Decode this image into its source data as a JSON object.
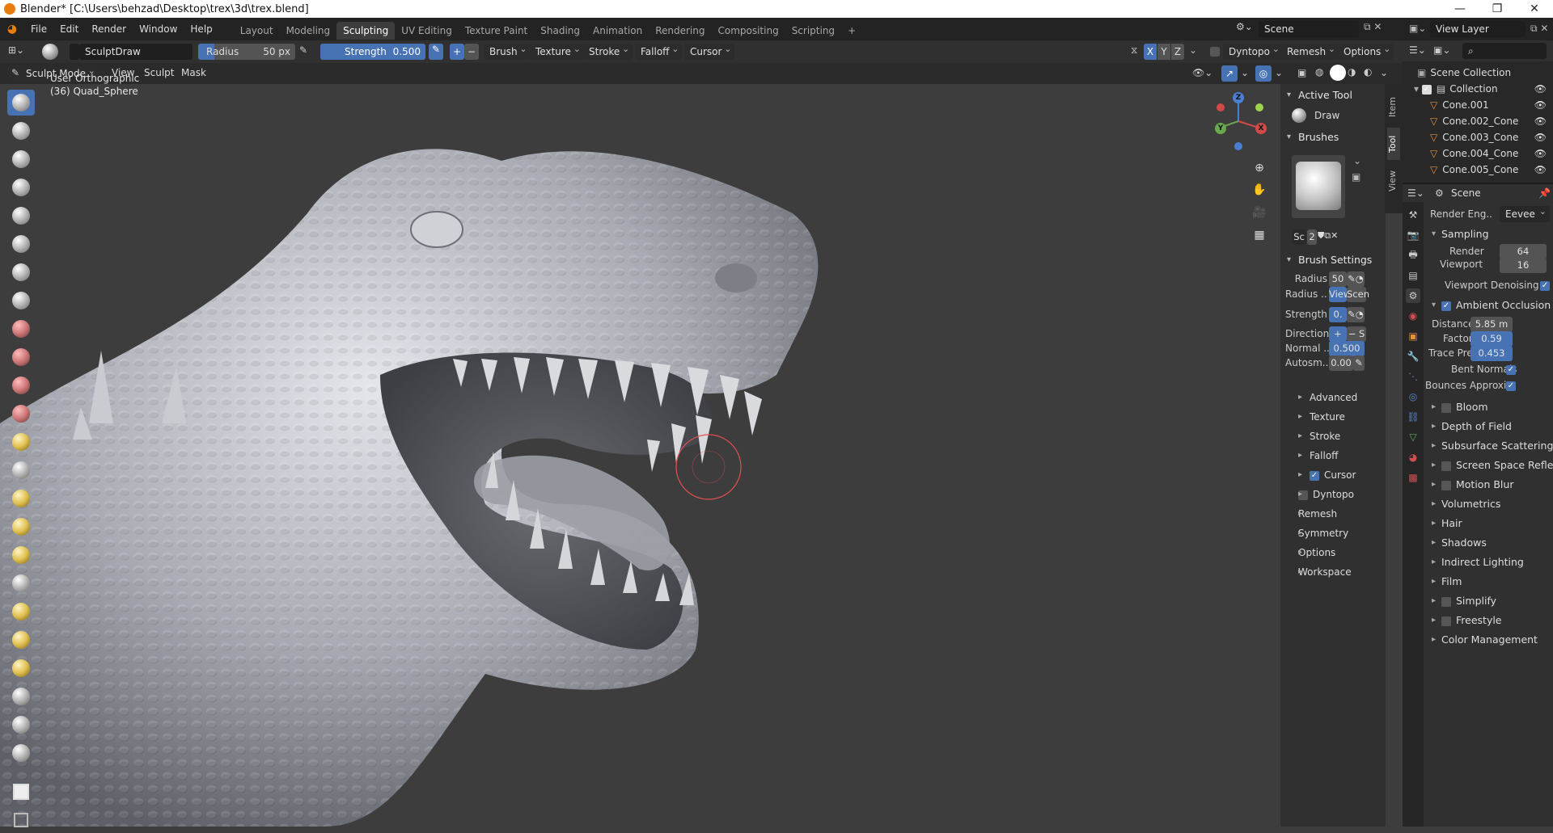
{
  "window": {
    "title": "Blender* [C:\\Users\\behzad\\Desktop\\trex\\3d\\trex.blend]",
    "min": "—",
    "max": "❐",
    "close": "✕"
  },
  "menu": [
    "File",
    "Edit",
    "Render",
    "Window",
    "Help"
  ],
  "workspaces": [
    "Layout",
    "Modeling",
    "Sculpting",
    "UV Editing",
    "Texture Paint",
    "Shading",
    "Animation",
    "Rendering",
    "Compositing",
    "Scripting",
    "+"
  ],
  "active_workspace": "Sculpting",
  "scene": {
    "label": "Scene",
    "view_layer": "View Layer"
  },
  "tool_header": {
    "brush_name": "SculptDraw",
    "radius_label": "Radius",
    "radius_value": "50 px",
    "strength_label": "Strength",
    "strength_value": "0.500",
    "plus": "+",
    "minus": "−",
    "menus": [
      "Brush",
      "Texture",
      "Stroke",
      "Falloff",
      "Cursor"
    ],
    "axes": [
      "X",
      "Y",
      "Z"
    ],
    "right_menus": [
      "Dyntopo",
      "Remesh",
      "Options"
    ]
  },
  "mode_header": {
    "mode": "Sculpt Mode",
    "menus": [
      "View",
      "Sculpt",
      "Mask"
    ]
  },
  "viewport": {
    "view_name": "User Orthographic",
    "object_info": "(36) Quad_Sphere"
  },
  "gizmo": {
    "x": "X",
    "y": "Y",
    "z": "Z"
  },
  "npanel": {
    "active_tool_header": "Active Tool",
    "active_tool_name": "Draw",
    "brushes_header": "Brushes",
    "brush_slot_name": "Sc",
    "brush_users": "2",
    "brush_settings_header": "Brush Settings",
    "radius_label": "Radius",
    "radius_value": "50",
    "radius_unit_label": "Radius ..",
    "radius_unit_view": "View",
    "radius_unit_scene": "Scen",
    "strength_label": "Strength",
    "strength_value": "0.",
    "direction_label": "Direction",
    "direction_add": "+",
    "direction_sub": "− S",
    "normal_label": "Normal ..",
    "normal_value": "0.500",
    "autosmooth_label": "Autosm..",
    "autosmooth_value": "0.00",
    "subs": [
      "Advanced",
      "Texture",
      "Stroke",
      "Falloff",
      "Cursor"
    ],
    "sections": [
      "Dyntopo",
      "Remesh",
      "Symmetry",
      "Options",
      "Workspace"
    ],
    "tabs": [
      "Item",
      "Tool",
      "View"
    ]
  },
  "outliner": {
    "root": "Scene Collection",
    "collection": "Collection",
    "items": [
      "Cone.001",
      "Cone.002_Cone",
      "Cone.003_Cone",
      "Cone.004_Cone",
      "Cone.005_Cone"
    ]
  },
  "properties": {
    "context": "Scene",
    "render_engine_label": "Render Eng..",
    "render_engine": "Eevee",
    "sampling": "Sampling",
    "render_label": "Render",
    "render_samples": "64",
    "viewport_label": "Viewport",
    "viewport_samples": "16",
    "viewport_denoising": "Viewport Denoising",
    "ao": "Ambient Occlusion",
    "distance_label": "Distance",
    "distance": "5.85 m",
    "factor_label": "Factor",
    "factor": "0.59",
    "trace_label": "Trace Pre..",
    "trace": "0.453",
    "bent_normals": "Bent Normals",
    "bounces": "Bounces Approxi..",
    "sections": [
      "Bloom",
      "Depth of Field",
      "Subsurface Scattering",
      "Screen Space Reflections",
      "Motion Blur",
      "Volumetrics",
      "Hair",
      "Shadows",
      "Indirect Lighting",
      "Film",
      "Simplify",
      "Freestyle",
      "Color Management"
    ]
  }
}
